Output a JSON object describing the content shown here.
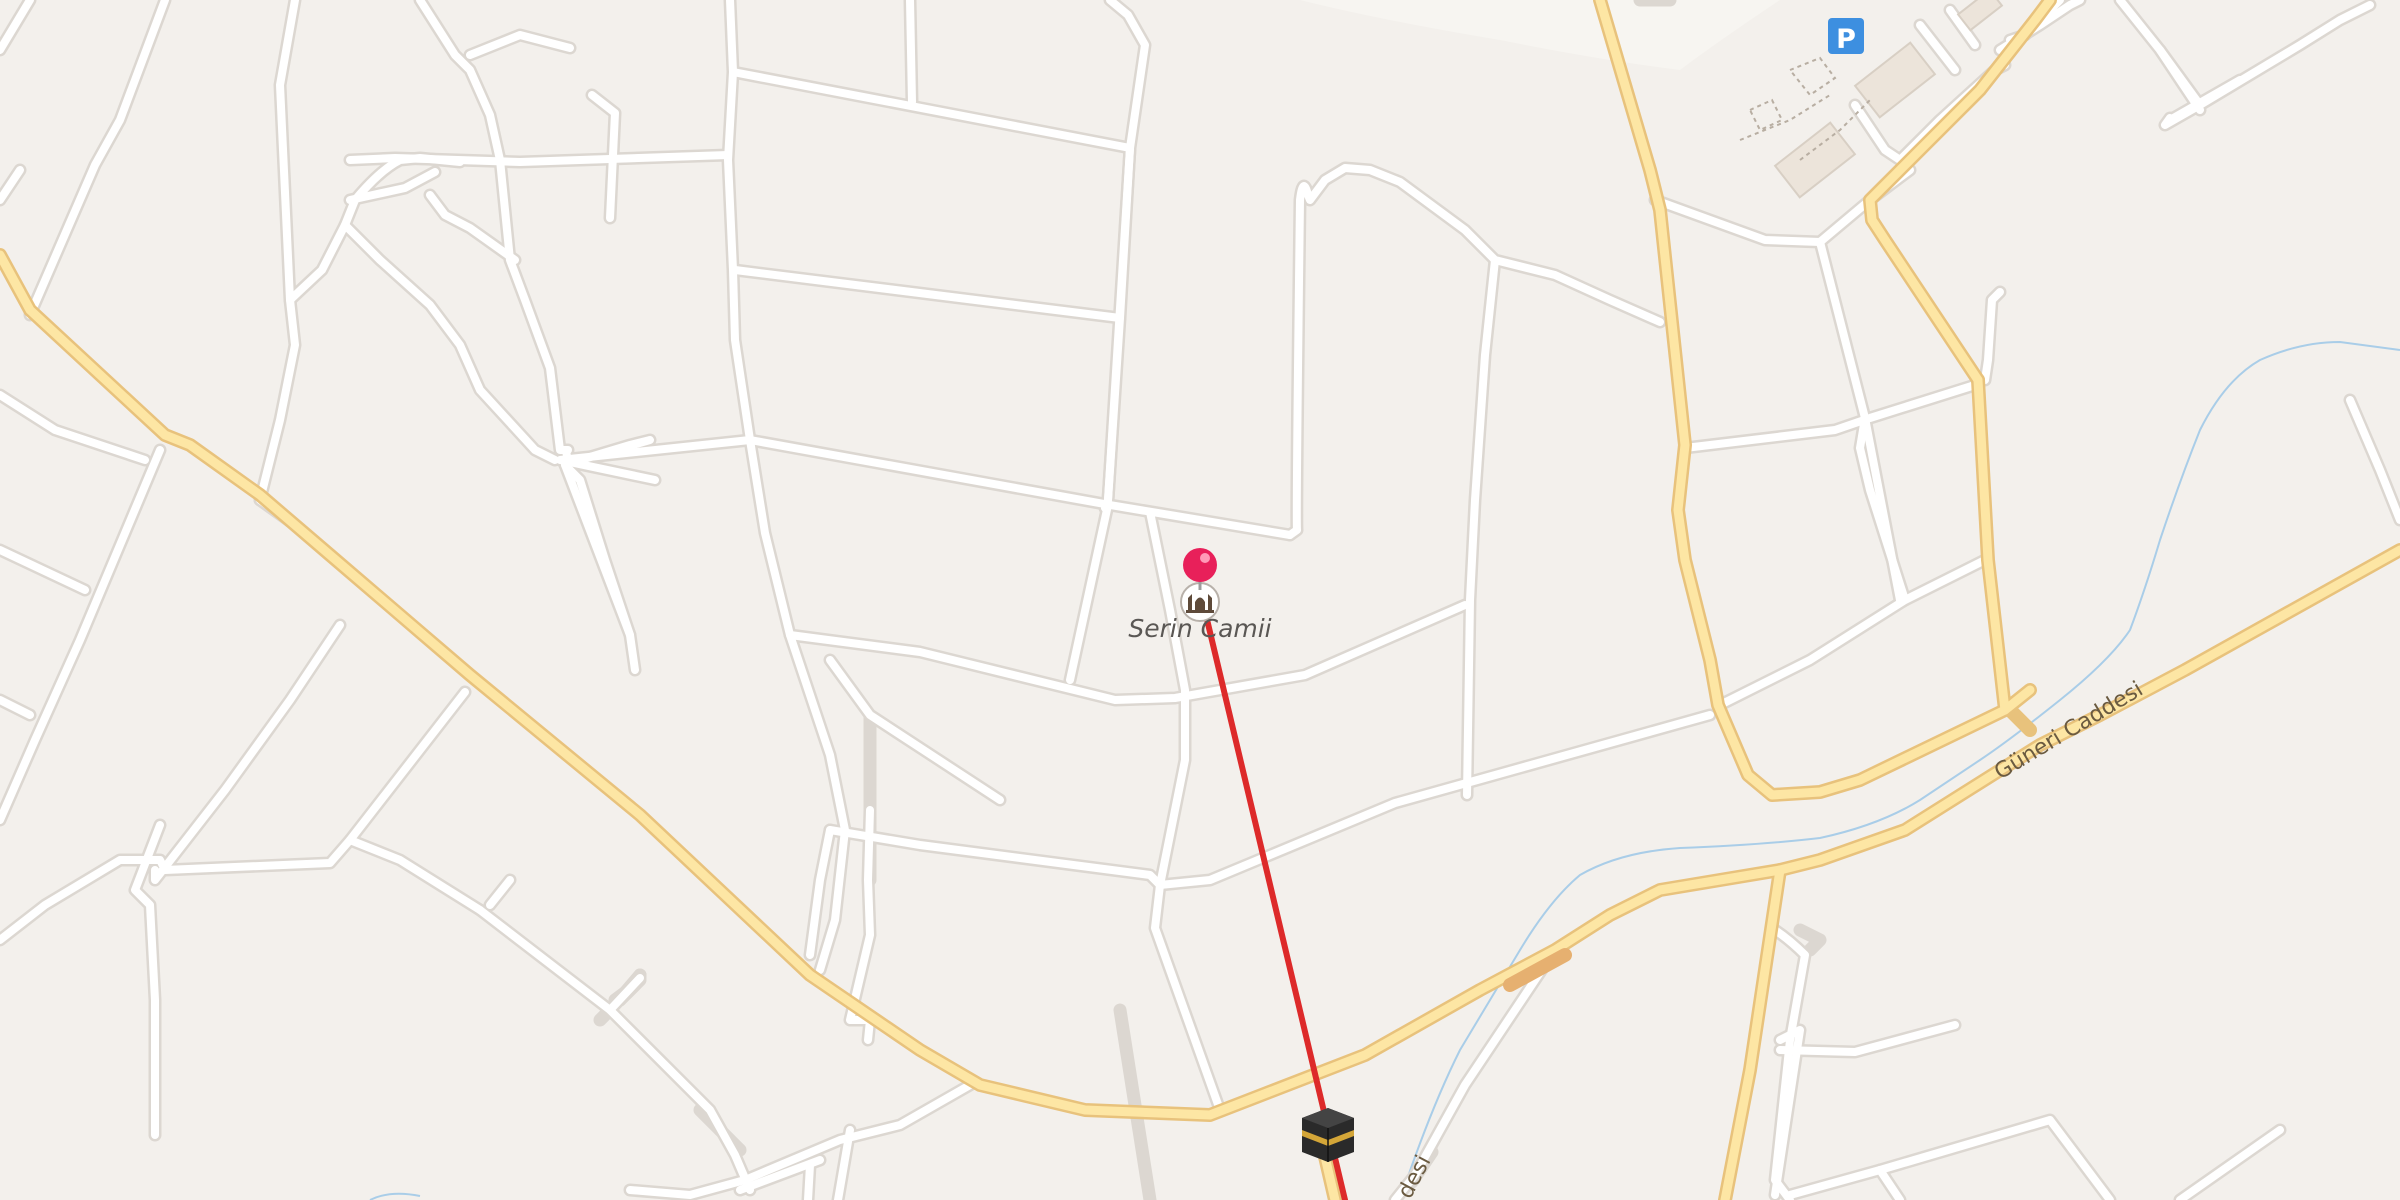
{
  "map": {
    "pin": {
      "label": "Serin Camii",
      "icon": "mosque-icon",
      "color": "#e8205a"
    },
    "qibla": {
      "line_color": "#dd2a2a",
      "marker_icon": "kaaba-icon"
    },
    "parking": {
      "label": "P",
      "icon": "parking-icon",
      "color": "#3d8fe0"
    },
    "streets": {
      "guneri": "Güneri Caddesi",
      "partial_bottom": "desi"
    },
    "colors": {
      "background": "#f3f0ec",
      "minor_road": "#ffffff",
      "major_road_fill": "#fde6a4",
      "major_road_casing": "#e8c27c",
      "water": "#a9cde8"
    }
  }
}
